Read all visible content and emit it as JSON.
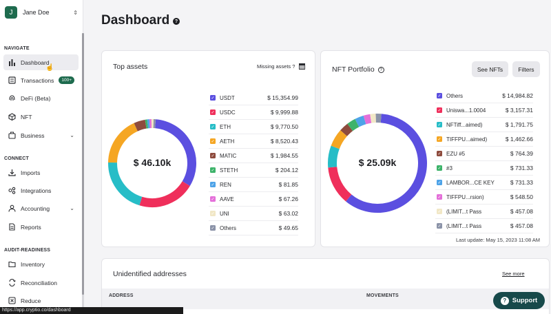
{
  "user": {
    "initial": "J",
    "name": "Jane Doe"
  },
  "sidebar": {
    "sections": [
      {
        "title": "NAVIGATE"
      },
      {
        "title": "CONNECT"
      },
      {
        "title": "AUDIT-READINESS"
      }
    ],
    "items": [
      {
        "label": "Dashboard",
        "icon": "bar-chart-icon"
      },
      {
        "label": "Transactions",
        "icon": "receipt-icon",
        "badge": "100+"
      },
      {
        "label": "DeFi (Beta)",
        "icon": "fingerprint-icon"
      },
      {
        "label": "NFT",
        "icon": "cube-icon"
      },
      {
        "label": "Business",
        "icon": "briefcase-icon"
      },
      {
        "label": "Imports",
        "icon": "download-icon"
      },
      {
        "label": "Integrations",
        "icon": "link-icon"
      },
      {
        "label": "Accounting",
        "icon": "person-icon"
      },
      {
        "label": "Reports",
        "icon": "document-icon"
      },
      {
        "label": "Inventory",
        "icon": "folder-icon"
      },
      {
        "label": "Reconciliation",
        "icon": "arrows-icon"
      },
      {
        "label": "Reduce",
        "icon": "reduce-icon"
      }
    ]
  },
  "page": {
    "title": "Dashboard"
  },
  "top_assets": {
    "title": "Top assets",
    "missing_link": "Missing assets ?",
    "total": "$ 46.10k",
    "items": [
      {
        "name": "USDT",
        "value": "$ 15,354.99",
        "color": "#5b4fe0"
      },
      {
        "name": "USDC",
        "value": "$ 9,999.88",
        "color": "#ef2f5b"
      },
      {
        "name": "ETH",
        "value": "$ 9,770.50",
        "color": "#27bdc7"
      },
      {
        "name": "AETH",
        "value": "$ 8,520.43",
        "color": "#f5a623"
      },
      {
        "name": "MATIC",
        "value": "$ 1,984.55",
        "color": "#8e4b3d"
      },
      {
        "name": "STETH",
        "value": "$ 204.12",
        "color": "#3db36a"
      },
      {
        "name": "REN",
        "value": "$ 81.85",
        "color": "#4ea3e8"
      },
      {
        "name": "AAVE",
        "value": "$ 67.26",
        "color": "#e46fd9"
      },
      {
        "name": "UNI",
        "value": "$ 63.02",
        "color": "#f1e7c6"
      },
      {
        "name": "Others",
        "value": "$ 49.65",
        "color": "#8b93a8"
      }
    ]
  },
  "nft_portfolio": {
    "title": "NFT Portfolio",
    "see_nfts": "See NFTs",
    "filters": "Filters",
    "total": "$ 25.09k",
    "last_update": "Last update: May 15, 2023 11:08 AM",
    "items": [
      {
        "name": "Others",
        "value": "$ 14,984.82",
        "color": "#5b4fe0"
      },
      {
        "name": "Uniswa...1.0004",
        "value": "$ 3,157.31",
        "color": "#ef2f5b"
      },
      {
        "name": "NFTiff...aimed)",
        "value": "$ 1,791.75",
        "color": "#27bdc7"
      },
      {
        "name": "TIFFPU...aimed)",
        "value": "$ 1,462.66",
        "color": "#f5a623"
      },
      {
        "name": "EZU #5",
        "value": "$ 764.39",
        "color": "#8e4b3d"
      },
      {
        "name": "#3",
        "value": "$ 731.33",
        "color": "#3db36a"
      },
      {
        "name": "LAMBOR...CE KEY",
        "value": "$ 731.33",
        "color": "#4ea3e8"
      },
      {
        "name": "TIFFPU...rsion)",
        "value": "$ 548.50",
        "color": "#e46fd9"
      },
      {
        "name": "(LIMIT...t Pass",
        "value": "$ 457.08",
        "color": "#f1e7c6"
      },
      {
        "name": "(LIMIT...t Pass",
        "value": "$ 457.08",
        "color": "#8b93a8"
      }
    ]
  },
  "unidentified": {
    "title": "Unidentified addresses",
    "see_more": "See more",
    "columns": [
      "ADDRESS",
      "MOVEMENTS"
    ]
  },
  "support": {
    "label": "Support"
  },
  "status_url": "https://app.cryptio.co/dashboard"
}
